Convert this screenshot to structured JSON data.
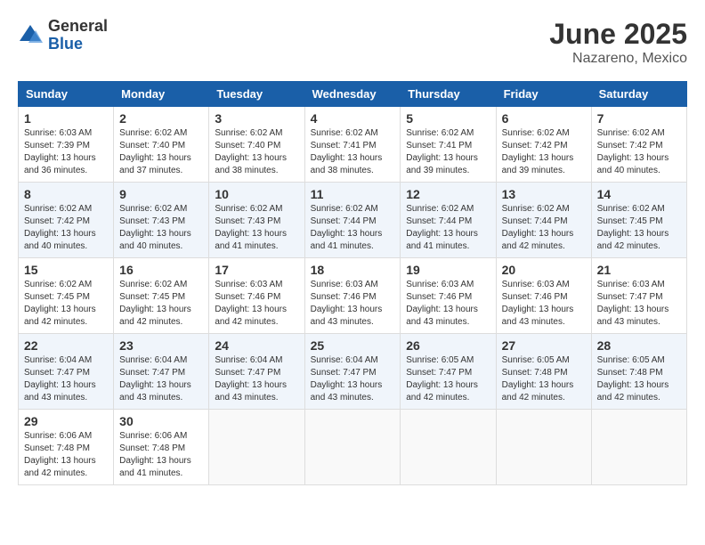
{
  "logo": {
    "general": "General",
    "blue": "Blue"
  },
  "title": "June 2025",
  "subtitle": "Nazareno, Mexico",
  "days_of_week": [
    "Sunday",
    "Monday",
    "Tuesday",
    "Wednesday",
    "Thursday",
    "Friday",
    "Saturday"
  ],
  "weeks": [
    [
      {
        "day": "1",
        "sunrise": "6:03 AM",
        "sunset": "7:39 PM",
        "daylight": "13 hours and 36 minutes."
      },
      {
        "day": "2",
        "sunrise": "6:02 AM",
        "sunset": "7:40 PM",
        "daylight": "13 hours and 37 minutes."
      },
      {
        "day": "3",
        "sunrise": "6:02 AM",
        "sunset": "7:40 PM",
        "daylight": "13 hours and 38 minutes."
      },
      {
        "day": "4",
        "sunrise": "6:02 AM",
        "sunset": "7:41 PM",
        "daylight": "13 hours and 38 minutes."
      },
      {
        "day": "5",
        "sunrise": "6:02 AM",
        "sunset": "7:41 PM",
        "daylight": "13 hours and 39 minutes."
      },
      {
        "day": "6",
        "sunrise": "6:02 AM",
        "sunset": "7:42 PM",
        "daylight": "13 hours and 39 minutes."
      },
      {
        "day": "7",
        "sunrise": "6:02 AM",
        "sunset": "7:42 PM",
        "daylight": "13 hours and 40 minutes."
      }
    ],
    [
      {
        "day": "8",
        "sunrise": "6:02 AM",
        "sunset": "7:42 PM",
        "daylight": "13 hours and 40 minutes."
      },
      {
        "day": "9",
        "sunrise": "6:02 AM",
        "sunset": "7:43 PM",
        "daylight": "13 hours and 40 minutes."
      },
      {
        "day": "10",
        "sunrise": "6:02 AM",
        "sunset": "7:43 PM",
        "daylight": "13 hours and 41 minutes."
      },
      {
        "day": "11",
        "sunrise": "6:02 AM",
        "sunset": "7:44 PM",
        "daylight": "13 hours and 41 minutes."
      },
      {
        "day": "12",
        "sunrise": "6:02 AM",
        "sunset": "7:44 PM",
        "daylight": "13 hours and 41 minutes."
      },
      {
        "day": "13",
        "sunrise": "6:02 AM",
        "sunset": "7:44 PM",
        "daylight": "13 hours and 42 minutes."
      },
      {
        "day": "14",
        "sunrise": "6:02 AM",
        "sunset": "7:45 PM",
        "daylight": "13 hours and 42 minutes."
      }
    ],
    [
      {
        "day": "15",
        "sunrise": "6:02 AM",
        "sunset": "7:45 PM",
        "daylight": "13 hours and 42 minutes."
      },
      {
        "day": "16",
        "sunrise": "6:02 AM",
        "sunset": "7:45 PM",
        "daylight": "13 hours and 42 minutes."
      },
      {
        "day": "17",
        "sunrise": "6:03 AM",
        "sunset": "7:46 PM",
        "daylight": "13 hours and 42 minutes."
      },
      {
        "day": "18",
        "sunrise": "6:03 AM",
        "sunset": "7:46 PM",
        "daylight": "13 hours and 43 minutes."
      },
      {
        "day": "19",
        "sunrise": "6:03 AM",
        "sunset": "7:46 PM",
        "daylight": "13 hours and 43 minutes."
      },
      {
        "day": "20",
        "sunrise": "6:03 AM",
        "sunset": "7:46 PM",
        "daylight": "13 hours and 43 minutes."
      },
      {
        "day": "21",
        "sunrise": "6:03 AM",
        "sunset": "7:47 PM",
        "daylight": "13 hours and 43 minutes."
      }
    ],
    [
      {
        "day": "22",
        "sunrise": "6:04 AM",
        "sunset": "7:47 PM",
        "daylight": "13 hours and 43 minutes."
      },
      {
        "day": "23",
        "sunrise": "6:04 AM",
        "sunset": "7:47 PM",
        "daylight": "13 hours and 43 minutes."
      },
      {
        "day": "24",
        "sunrise": "6:04 AM",
        "sunset": "7:47 PM",
        "daylight": "13 hours and 43 minutes."
      },
      {
        "day": "25",
        "sunrise": "6:04 AM",
        "sunset": "7:47 PM",
        "daylight": "13 hours and 43 minutes."
      },
      {
        "day": "26",
        "sunrise": "6:05 AM",
        "sunset": "7:47 PM",
        "daylight": "13 hours and 42 minutes."
      },
      {
        "day": "27",
        "sunrise": "6:05 AM",
        "sunset": "7:48 PM",
        "daylight": "13 hours and 42 minutes."
      },
      {
        "day": "28",
        "sunrise": "6:05 AM",
        "sunset": "7:48 PM",
        "daylight": "13 hours and 42 minutes."
      }
    ],
    [
      {
        "day": "29",
        "sunrise": "6:06 AM",
        "sunset": "7:48 PM",
        "daylight": "13 hours and 42 minutes."
      },
      {
        "day": "30",
        "sunrise": "6:06 AM",
        "sunset": "7:48 PM",
        "daylight": "13 hours and 41 minutes."
      },
      null,
      null,
      null,
      null,
      null
    ]
  ]
}
